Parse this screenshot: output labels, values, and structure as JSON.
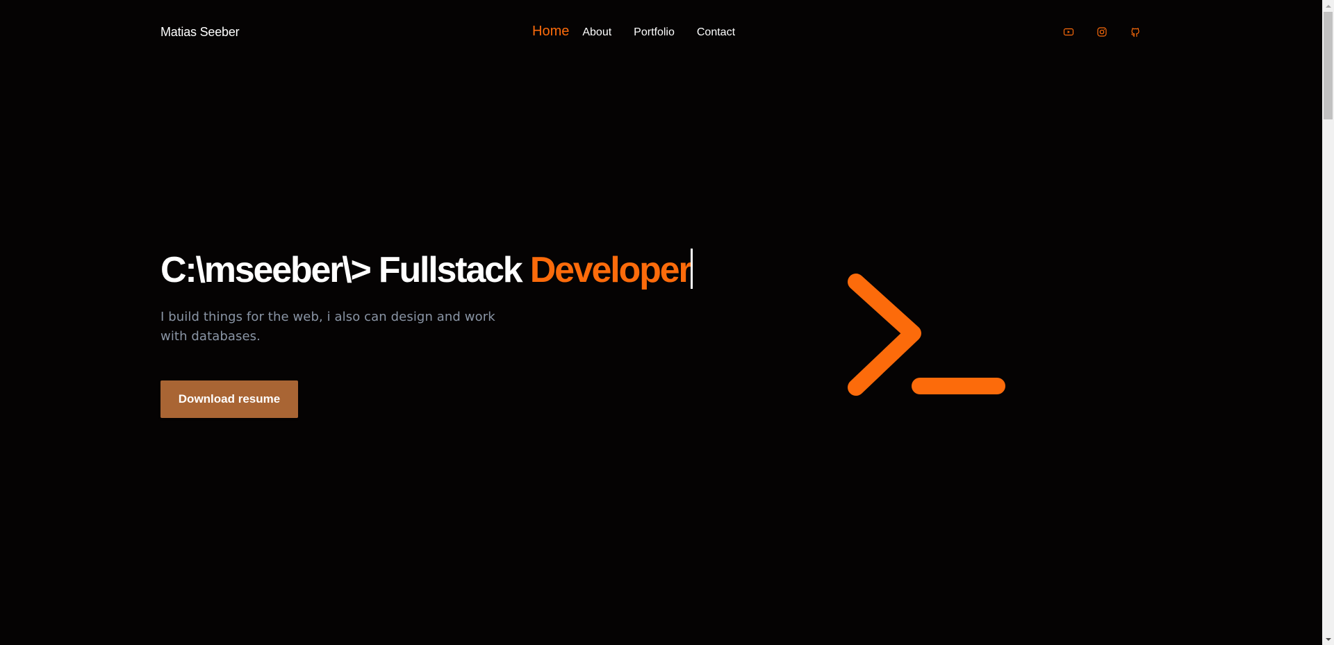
{
  "header": {
    "brand": "Matias Seeber",
    "nav": [
      {
        "label": "Home",
        "active": true
      },
      {
        "label": "About",
        "active": false
      },
      {
        "label": "Portfolio",
        "active": false
      },
      {
        "label": "Contact",
        "active": false
      }
    ],
    "socials": [
      {
        "icon": "youtube-icon"
      },
      {
        "icon": "instagram-icon"
      },
      {
        "icon": "github-icon"
      }
    ]
  },
  "hero": {
    "headline_prefix": "C:\\mseeber\\> Fullstack ",
    "headline_accent": "Developer",
    "subtitle": "I build things for the web, i also can design and work with databases.",
    "cta_label": "Download resume",
    "graphic_icon": "terminal-prompt-icon"
  },
  "colors": {
    "background": "#050303",
    "accent": "#fc6b0b",
    "button": "#a96534",
    "subtitle": "#8a95a5",
    "text": "#ffffff"
  }
}
